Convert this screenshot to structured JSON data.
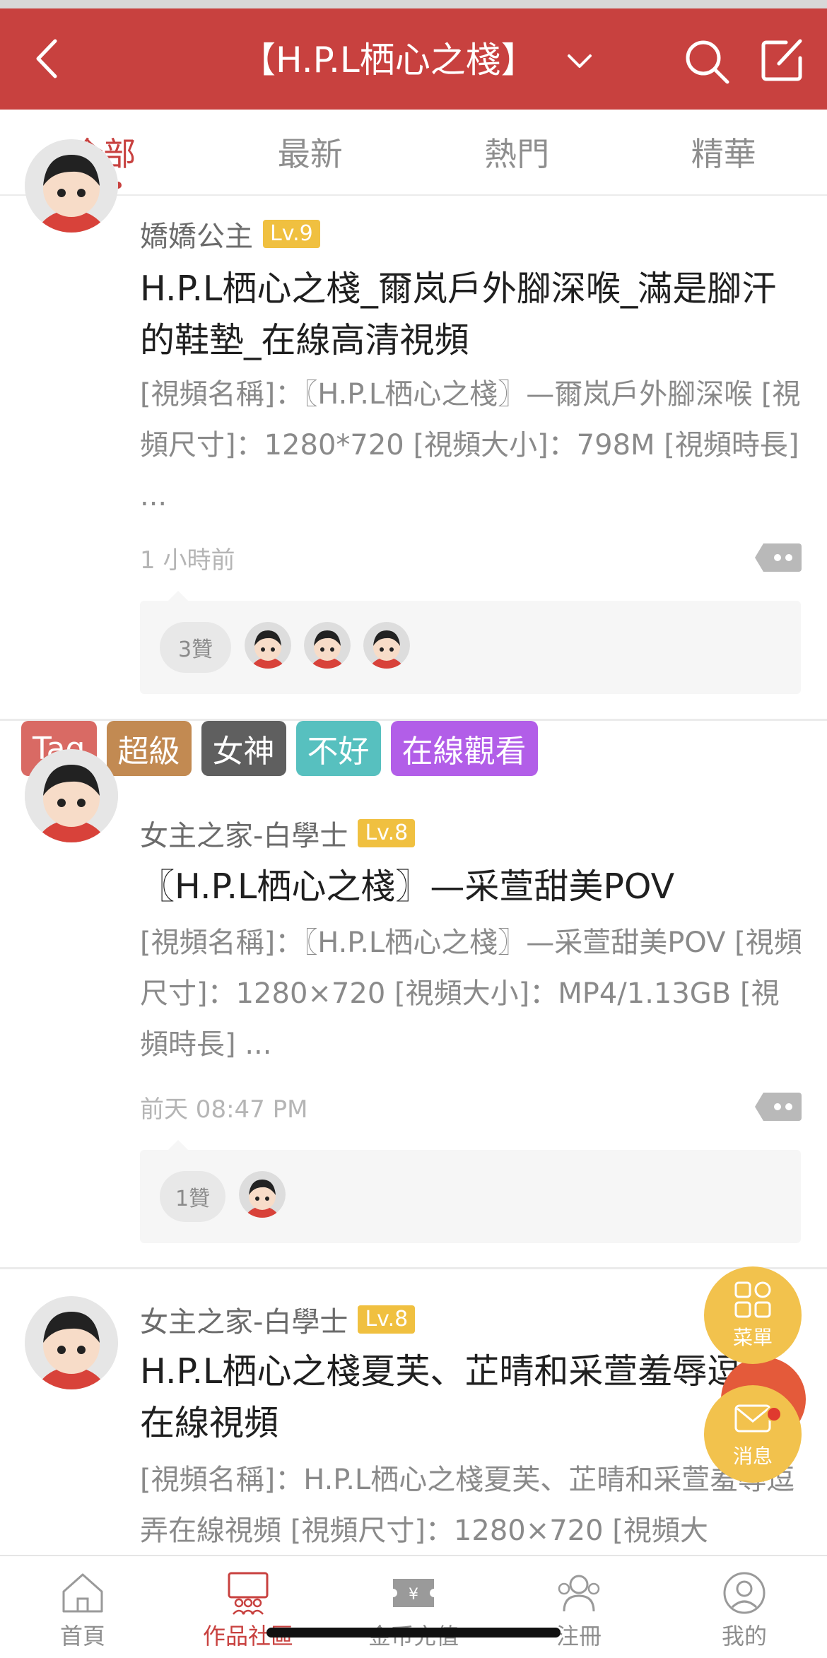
{
  "header": {
    "title": "【H.P.L栖心之棧】",
    "colors": {
      "primary": "#c8413f",
      "level_badge": "#f0c040"
    }
  },
  "tabs": [
    {
      "label": "全部",
      "active": true
    },
    {
      "label": "最新",
      "active": false
    },
    {
      "label": "熱門",
      "active": false
    },
    {
      "label": "精華",
      "active": false
    }
  ],
  "posts": [
    {
      "user": "嬌嬌公主",
      "level": "Lv.9",
      "title": "H.P.L栖心之棧_爾岚戶外腳深喉_滿是腳汗的鞋墊_在線高清視頻",
      "excerpt": "[視頻名稱]：〖H.P.L栖心之棧〗—爾岚戶外腳深喉 [視頻尺寸]：1280*720 [視頻大小]：798M [視頻時長] ...",
      "time": "1 小時前",
      "likes": "3贊",
      "liker_count": 3
    },
    {
      "user": "女主之家-白學士",
      "level": "Lv.8",
      "title": "〖H.P.L栖心之棧〗—采萱甜美POV",
      "excerpt": "[視頻名稱]：〖H.P.L栖心之棧〗—采萱甜美POV [視頻尺寸]：1280×720 [視頻大小]：MP4/1.13GB [視頻時長] ...",
      "time": "前天 08:47 PM",
      "likes": "1贊",
      "liker_count": 1
    },
    {
      "user": "女主之家-白學士",
      "level": "Lv.8",
      "title": "H.P.L栖心之棧夏芙、芷晴和采萱羞辱逗弄在線視頻",
      "excerpt": "[視頻名稱]：H.P.L栖心之棧夏芙、芷晴和采萱羞辱逗弄在線視頻 [視頻尺寸]：1280×720 [視頻大"
    }
  ],
  "tag_row": [
    {
      "label": "Tag",
      "color": "#d96a64"
    },
    {
      "label": "超級",
      "color": "#c28a52"
    },
    {
      "label": "女神",
      "color": "#5f5f5f"
    },
    {
      "label": "不好",
      "color": "#57c0bf"
    },
    {
      "label": "在線觀看",
      "color": "#b25ee8"
    }
  ],
  "fabs": {
    "menu_label": "菜單",
    "message_label": "消息",
    "color": "#f2c24d"
  },
  "bottom_nav": [
    {
      "label": "首頁",
      "icon": "home-icon",
      "active": false
    },
    {
      "label": "作品社區",
      "icon": "community-icon",
      "active": true
    },
    {
      "label": "金币充值",
      "icon": "coin-ticket-icon",
      "active": false
    },
    {
      "label": "注冊",
      "icon": "users-icon",
      "active": false
    },
    {
      "label": "我的",
      "icon": "profile-icon",
      "active": false
    }
  ]
}
